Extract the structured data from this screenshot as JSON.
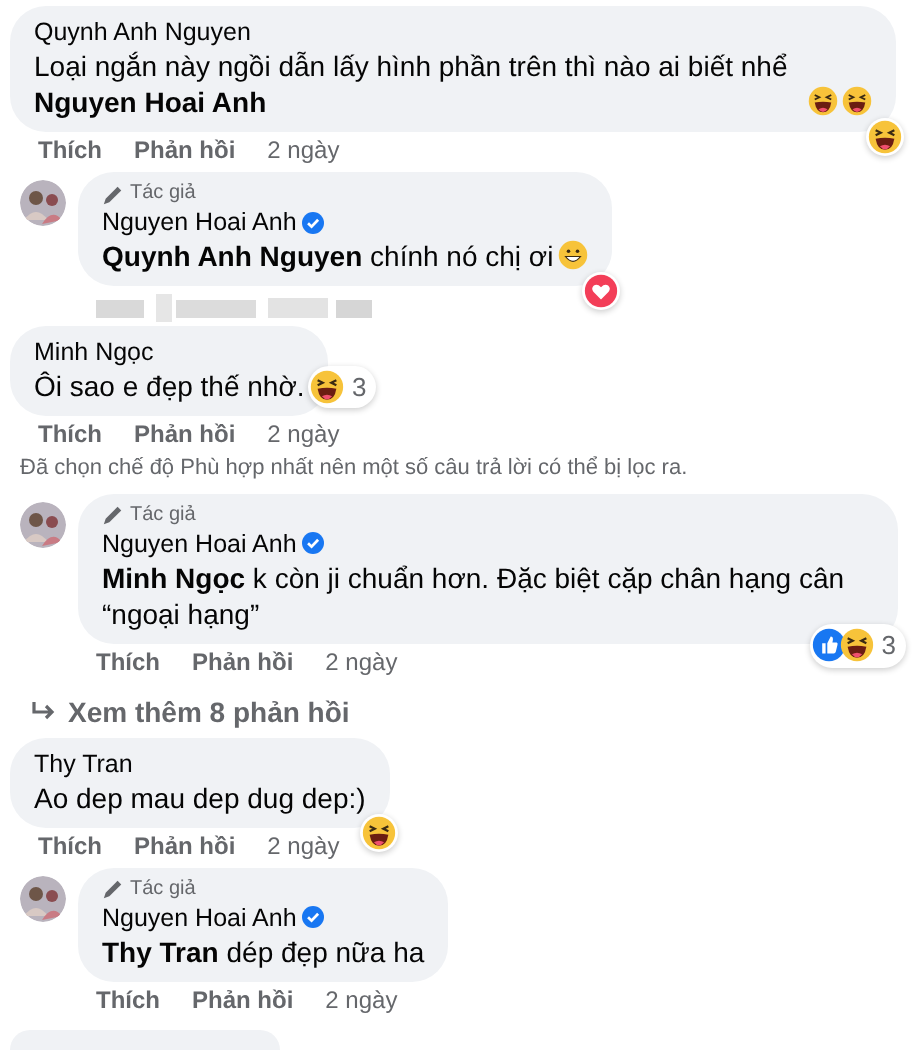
{
  "thread": [
    {
      "kind": "comment",
      "author": "Quynh Anh Nguyen",
      "text": "Loại ngắn này ngồi dẫn lấy hình phần trên thì nào ai biết nhể **Nguyen Hoai Anh**",
      "emojis": [
        {
          "kind": "laugh"
        },
        {
          "kind": "laugh"
        }
      ],
      "reactions": [
        {
          "kind": "laugh"
        }
      ],
      "actions": {
        "like": "Thích",
        "reply": "Phản hồi",
        "time": "2 ngày"
      }
    },
    {
      "kind": "reply",
      "badge": "Tác giả",
      "author": "Nguyen Hoai Anh",
      "verified": true,
      "text": "**Quynh Anh Nguyen** chính nó chị ơi",
      "emojis": [
        {
          "kind": "grin"
        }
      ],
      "reactions": [
        {
          "kind": "heart"
        }
      ],
      "blurred": true
    },
    {
      "kind": "comment",
      "author": "Minh Ngọc",
      "text": "Ôi sao e đẹp thế nhờ.",
      "reactions": [
        {
          "kind": "laugh"
        }
      ],
      "reaction_count": "3",
      "actions": {
        "like": "Thích",
        "reply": "Phản hồi",
        "time": "2 ngày"
      }
    },
    {
      "kind": "notice",
      "text": "Đã chọn chế độ Phù hợp nhất nên một số câu trả lời có thể bị lọc ra."
    },
    {
      "kind": "reply",
      "badge": "Tác giả",
      "author": "Nguyen Hoai Anh",
      "verified": true,
      "text": "**Minh Ngọc** k còn ji chuẩn hơn. Đặc biệt cặp chân hạng cân “ngoại hạng”",
      "reactions": [
        {
          "kind": "like"
        },
        {
          "kind": "laugh"
        }
      ],
      "reaction_count": "3",
      "actions": {
        "like": "Thích",
        "reply": "Phản hồi",
        "time": "2 ngày"
      }
    },
    {
      "kind": "more",
      "text": "Xem thêm 8 phản hồi"
    },
    {
      "kind": "comment",
      "author": "Thy Tran",
      "text": "Ao dep mau dep dug dep:)",
      "reactions": [
        {
          "kind": "laugh"
        }
      ],
      "actions": {
        "like": "Thích",
        "reply": "Phản hồi",
        "time": "2 ngày"
      }
    },
    {
      "kind": "reply",
      "badge": "Tác giả",
      "author": "Nguyen Hoai Anh",
      "verified": true,
      "text": "**Thy Tran** dép đẹp nữa ha",
      "actions": {
        "like": "Thích",
        "reply": "Phản hồi",
        "time": "2 ngày"
      }
    },
    {
      "kind": "cut_off"
    }
  ]
}
